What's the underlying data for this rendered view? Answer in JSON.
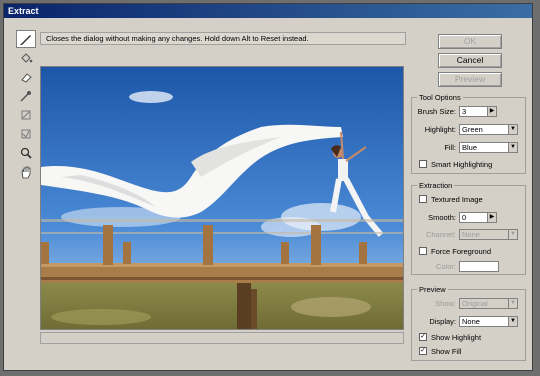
{
  "window": {
    "title": "Extract"
  },
  "status": {
    "message": "Closes the dialog without making any changes. Hold down Alt to Reset instead."
  },
  "buttons": {
    "ok": "OK",
    "cancel": "Cancel",
    "preview": "Preview"
  },
  "tools": [
    "edge-highlighter",
    "fill",
    "eraser",
    "eyedropper",
    "cleanup",
    "edge-touchup",
    "zoom",
    "hand"
  ],
  "tool_options": {
    "title": "Tool Options",
    "brush_size_label": "Brush Size:",
    "brush_size": "3",
    "highlight_label": "Highlight:",
    "highlight": "Green",
    "fill_label": "Fill:",
    "fill": "Blue",
    "smart_label": "Smart Highlighting"
  },
  "extraction": {
    "title": "Extraction",
    "textured_label": "Textured Image",
    "smooth_label": "Smooth:",
    "smooth": "0",
    "channel_label": "Channel:",
    "channel": "None",
    "force_label": "Force Foreground",
    "color_label": "Color:"
  },
  "preview_group": {
    "title": "Preview",
    "show_label": "Show:",
    "show": "Original",
    "display_label": "Display:",
    "display": "None",
    "show_highlight_label": "Show Highlight",
    "show_highlight_checked": true,
    "show_fill_label": "Show Fill",
    "show_fill_checked": true
  },
  "colors": {
    "title_bar": "#0a246a",
    "dialog_bg": "#d4d0c8",
    "sky": "#2e6fc4"
  }
}
